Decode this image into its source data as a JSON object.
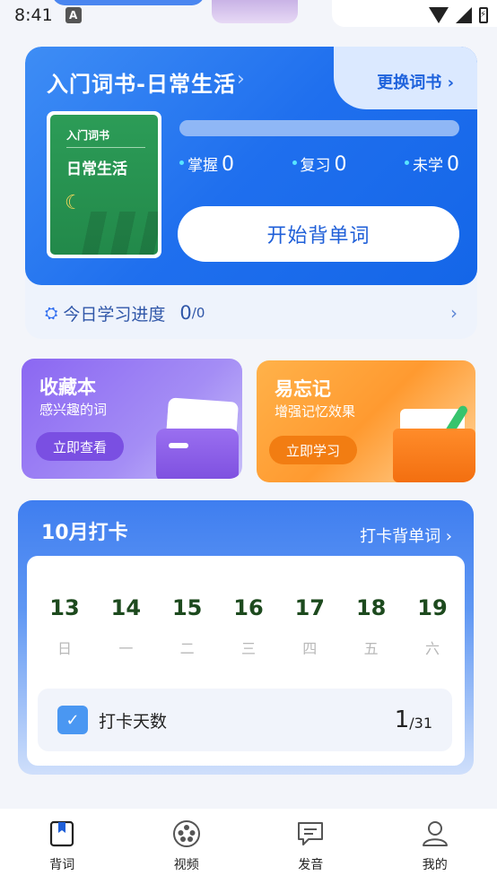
{
  "status_bar": {
    "time": "8:41",
    "badge": "A"
  },
  "book": {
    "title": "入门词书-日常生活",
    "title_chevron": "›",
    "change_label": "更换词书",
    "change_chevron": "›",
    "cover_small": "入门词书",
    "cover_big": "日常生活",
    "stats": [
      {
        "label": "掌握",
        "value": "0"
      },
      {
        "label": "复习",
        "value": "0"
      },
      {
        "label": "未学",
        "value": "0"
      }
    ],
    "start_label": "开始背单词",
    "today_label": "今日学习进度",
    "today_num": "0",
    "today_den": "/0"
  },
  "favorites": {
    "title": "收藏本",
    "subtitle": "感兴趣的词",
    "button": "立即查看"
  },
  "forgetful": {
    "title": "易忘记",
    "subtitle": "增强记忆效果",
    "button": "立即学习"
  },
  "checkin": {
    "title": "10月打卡",
    "link_label": "打卡背单词 ›",
    "days": [
      {
        "num": "13",
        "week": "日"
      },
      {
        "num": "14",
        "week": "一"
      },
      {
        "num": "15",
        "week": "二"
      },
      {
        "num": "16",
        "week": "三"
      },
      {
        "num": "17",
        "week": "四"
      },
      {
        "num": "18",
        "week": "五"
      },
      {
        "num": "19",
        "week": "六"
      }
    ],
    "summary_label": "打卡天数",
    "summary_num": "1",
    "summary_den": "/31"
  },
  "nav": [
    {
      "label": "背词",
      "icon": "bookmark-book-icon"
    },
    {
      "label": "视频",
      "icon": "film-reel-icon"
    },
    {
      "label": "发音",
      "icon": "chat-bubble-icon"
    },
    {
      "label": "我的",
      "icon": "user-profile-icon"
    }
  ],
  "colors": {
    "primary": "#1f6fee",
    "purple": "#8b67f2",
    "orange": "#ff9a30",
    "green": "#22894a"
  }
}
